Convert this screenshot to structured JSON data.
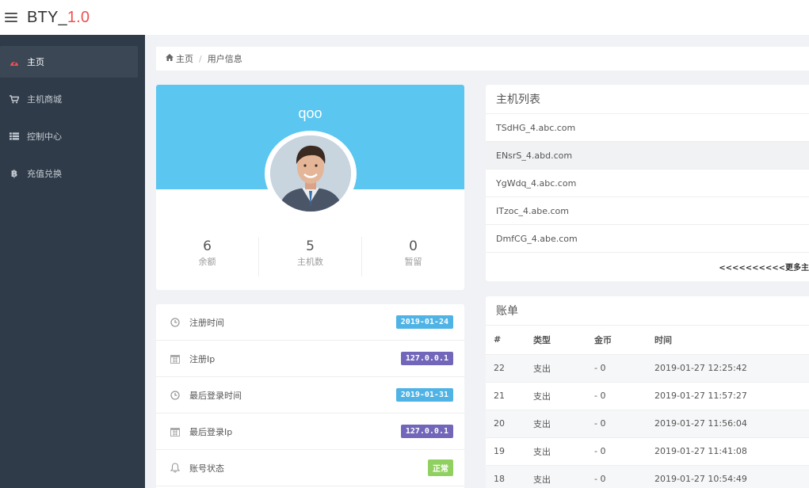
{
  "app": {
    "brand": "BTY_",
    "version": "1.0"
  },
  "sidebar": {
    "items": [
      {
        "label": "主页",
        "icon": "dashboard-icon",
        "active": true
      },
      {
        "label": "主机商城",
        "icon": "cart-icon",
        "active": false
      },
      {
        "label": "控制中心",
        "icon": "list-icon",
        "active": false
      },
      {
        "label": "充值兑换",
        "icon": "bitcoin-icon",
        "active": false
      }
    ]
  },
  "breadcrumb": {
    "home": "主页",
    "current": "用户信息"
  },
  "profile": {
    "username": "qoo",
    "stats": [
      {
        "value": "6",
        "label": "余额"
      },
      {
        "value": "5",
        "label": "主机数"
      },
      {
        "value": "0",
        "label": "暂留"
      }
    ]
  },
  "info": [
    {
      "label": "注册时间",
      "icon": "clock-icon",
      "value": "2019-01-24",
      "color": "blue"
    },
    {
      "label": "注册Ip",
      "icon": "calendar-icon",
      "value": "127.0.0.1",
      "color": "purple"
    },
    {
      "label": "最后登录时间",
      "icon": "clock-icon",
      "value": "2019-01-31",
      "color": "blue"
    },
    {
      "label": "最后登录Ip",
      "icon": "calendar-icon",
      "value": "127.0.0.1",
      "color": "purple"
    },
    {
      "label": "账号状态",
      "icon": "bell-icon",
      "value": "正常",
      "color": "green"
    }
  ],
  "hosts": {
    "title": "主机列表",
    "items": [
      "TSdHG_4.abc.com",
      "ENsrS_4.abd.com",
      "YgWdq_4.abc.com",
      "ITzoc_4.abe.com",
      "DmfCG_4.abe.com"
    ],
    "more": "<<<<<<<<<<更多主"
  },
  "bill": {
    "title": "账单",
    "headers": [
      "#",
      "类型",
      "金币",
      "时间"
    ],
    "rows": [
      [
        "22",
        "支出",
        "- 0",
        "2019-01-27 12:25:42"
      ],
      [
        "21",
        "支出",
        "- 0",
        "2019-01-27 11:57:27"
      ],
      [
        "20",
        "支出",
        "- 0",
        "2019-01-27 11:56:04"
      ],
      [
        "19",
        "支出",
        "- 0",
        "2019-01-27 11:41:08"
      ],
      [
        "18",
        "支出",
        "- 0",
        "2019-01-27 10:54:49"
      ]
    ]
  },
  "colors": {
    "accent": "#5bc6f0",
    "sidebar": "#2f3b49",
    "brand_version": "#f05050",
    "badge_blue": "#4fb3e5",
    "badge_purple": "#7266ba",
    "badge_green": "#90d060"
  }
}
